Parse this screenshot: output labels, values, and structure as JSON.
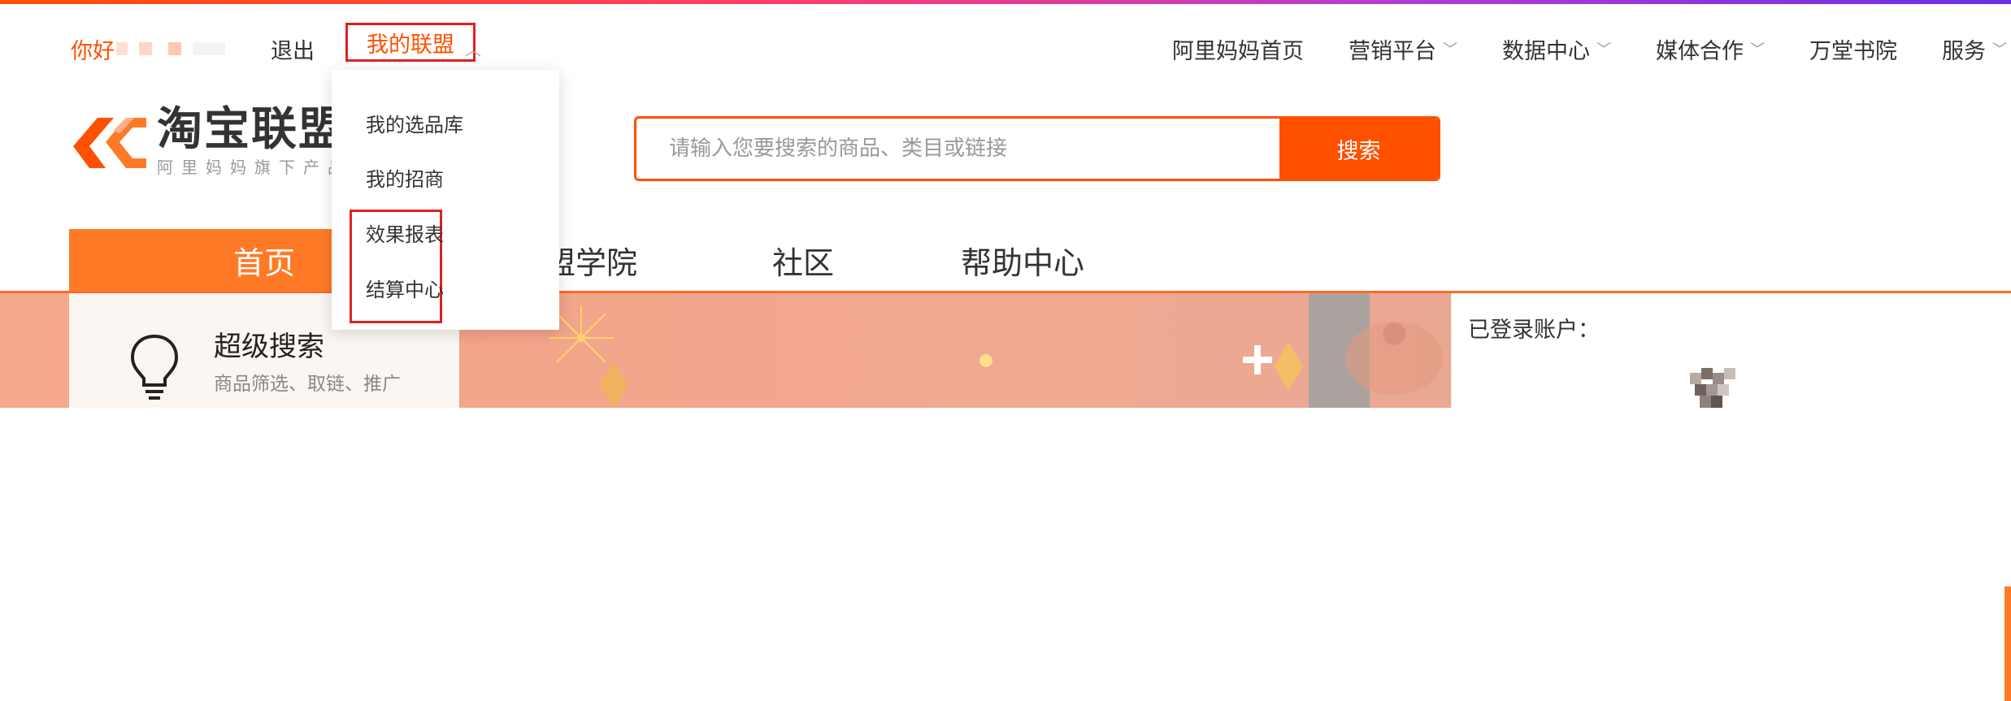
{
  "top_nav": {
    "greeting": "你好",
    "logout": "退出",
    "my_alliance": "我的联盟",
    "right_items": [
      {
        "label": "阿里妈妈首页",
        "has_chevron": false
      },
      {
        "label": "营销平台",
        "has_chevron": true
      },
      {
        "label": "数据中心",
        "has_chevron": true
      },
      {
        "label": "媒体合作",
        "has_chevron": true
      },
      {
        "label": "万堂书院",
        "has_chevron": false
      },
      {
        "label": "服务",
        "has_chevron": true
      }
    ]
  },
  "logo": {
    "title": "淘宝联盟",
    "subtitle": "阿里妈妈旗下产品"
  },
  "search": {
    "placeholder": "请输入您要搜索的商品、类目或链接",
    "button": "搜索"
  },
  "main_nav": {
    "home": "首页",
    "items": [
      "盟学院",
      "社区",
      "帮助中心"
    ]
  },
  "dropdown": {
    "items": [
      "我的选品库",
      "我的招商",
      "效果报表",
      "结算中心"
    ]
  },
  "feature": {
    "title": "超级搜索",
    "subtitle": "商品筛选、取链、推广"
  },
  "account": {
    "label": "已登录账户："
  },
  "colors": {
    "accent": "#ff5000",
    "nav_home_bg": "#ff7a26",
    "highlight_border": "#e02020"
  }
}
